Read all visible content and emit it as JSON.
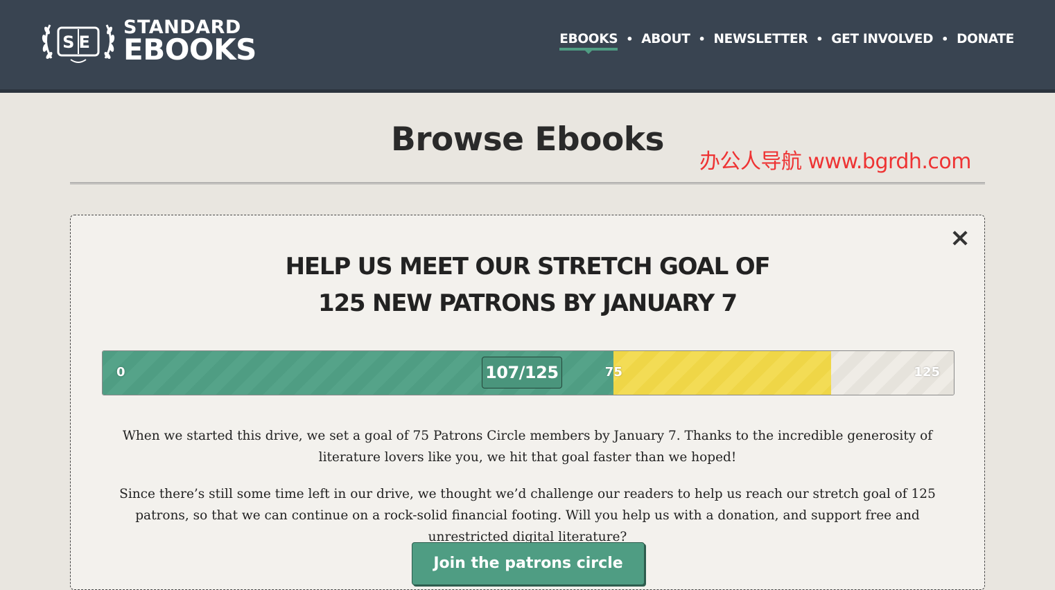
{
  "header": {
    "logo_line1": "STANDARD",
    "logo_line2": "EBOOKS",
    "logo_mark": "SE",
    "nav": [
      {
        "label": "EBOOKS",
        "active": true
      },
      {
        "label": "ABOUT",
        "active": false
      },
      {
        "label": "NEWSLETTER",
        "active": false
      },
      {
        "label": "GET INVOLVED",
        "active": false
      },
      {
        "label": "DONATE",
        "active": false
      }
    ],
    "nav_separator": "•"
  },
  "page": {
    "title": "Browse Ebooks",
    "watermark": "办公人导航 www.bgrdh.com"
  },
  "donation": {
    "close_icon": "×",
    "heading_line1": "HELP US MEET OUR STRETCH GOAL OF",
    "heading_line2": "125 NEW PATRONS BY JANUARY 7",
    "progress": {
      "start_label": "0",
      "goal_label": "75",
      "stretch_label": "125",
      "count_label": "107/125",
      "current": 107,
      "goal": 75,
      "stretch_goal": 125,
      "max_shown": 125,
      "colors": {
        "achieved": "#4f9d83",
        "stretch": "#efd647",
        "remaining": "#e6e3dc"
      }
    },
    "paragraph1": "When we started this drive, we set a goal of 75 Patrons Circle members by January 7. Thanks to the incredible generosity of literature lovers like you, we hit that goal faster than we hoped!",
    "paragraph2": "Since there’s still some time left in our drive, we thought we’d challenge our readers to help us reach our stretch goal of 125 patrons, so that we can continue on a rock-solid financial footing. Will you help us with a donation, and support free and unrestricted digital literature?",
    "cta_label": "Join the patrons circle"
  }
}
